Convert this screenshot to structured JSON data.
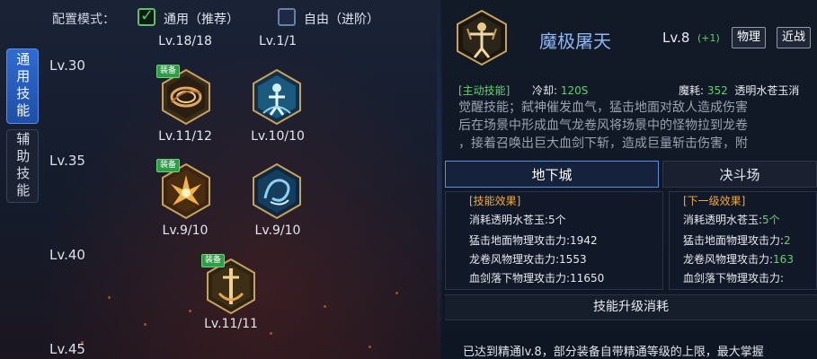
{
  "config": {
    "label": "配置模式：",
    "option_general": "通用（推荐）",
    "option_free": "自由（进阶）"
  },
  "side_tabs": [
    "通用技能",
    "辅助技能"
  ],
  "levels": [
    "Lv.30",
    "Lv.35",
    "Lv.40",
    "Lv.45"
  ],
  "top_row_levels": [
    "Lv.18/18",
    "Lv.1/1"
  ],
  "skills": [
    {
      "level": "Lv.11/12",
      "badge": "装备",
      "icon": "whirlwind-skill-icon"
    },
    {
      "level": "Lv.10/10",
      "badge": "",
      "icon": "aura-figure-skill-icon"
    },
    {
      "level": "Lv.9/10",
      "badge": "装备",
      "icon": "flame-burst-skill-icon"
    },
    {
      "level": "Lv.9/10",
      "badge": "",
      "icon": "dragon-spiral-skill-icon"
    },
    {
      "level": "Lv.11/11",
      "badge": "装备",
      "icon": "blood-sword-skill-icon"
    }
  ],
  "detail": {
    "name": "魔极屠天",
    "level": "Lv.8",
    "bonus": "(+1)",
    "tags": [
      "物理",
      "近战"
    ],
    "skill_type": "[主动技能]",
    "cooldown_label": "冷却: ",
    "cooldown_value": "120S",
    "mana_label": "魔耗: ",
    "mana_value": "352",
    "mana_extra": "透明水苍玉消",
    "description": [
      "觉醒技能；弑神催发血气，猛击地面对敌人造成伤害",
      "后在场景中形成血气龙卷风将场景中的怪物拉到龙卷",
      "，接着召唤出巨大血剑下斩，造成巨量斩击伤害，附"
    ],
    "mode_tabs": [
      "地下城",
      "决斗场"
    ],
    "current_title": "[技能效果]",
    "next_title": "[下一级效果]",
    "current_effects": [
      {
        "label": "消耗透明水苍玉:",
        "value": "5个"
      },
      {
        "label": "猛击地面物理攻击力:",
        "value": "1942"
      },
      {
        "label": "龙卷风物理攻击力:",
        "value": "1553"
      },
      {
        "label": "血剑落下物理攻击力:",
        "value": "11650"
      }
    ],
    "next_effects": [
      {
        "label": "消耗透明水苍玉:",
        "value": "5个"
      },
      {
        "label": "猛击地面物理攻击力:",
        "value": "2"
      },
      {
        "label": "龙卷风物理攻击力:",
        "value": "163"
      },
      {
        "label": "血剑落下物理攻击力:",
        "value": ""
      }
    ],
    "upgrade_label": "技能升级消耗",
    "bottom_note": "已达到精通lv.8，部分装备自带精通等级的上限，最大掌握"
  },
  "colors": {
    "accent_blue": "#2f6bd0",
    "green": "#5fd46c",
    "orange": "#f0a93a",
    "name_blue": "#8db6f2"
  }
}
